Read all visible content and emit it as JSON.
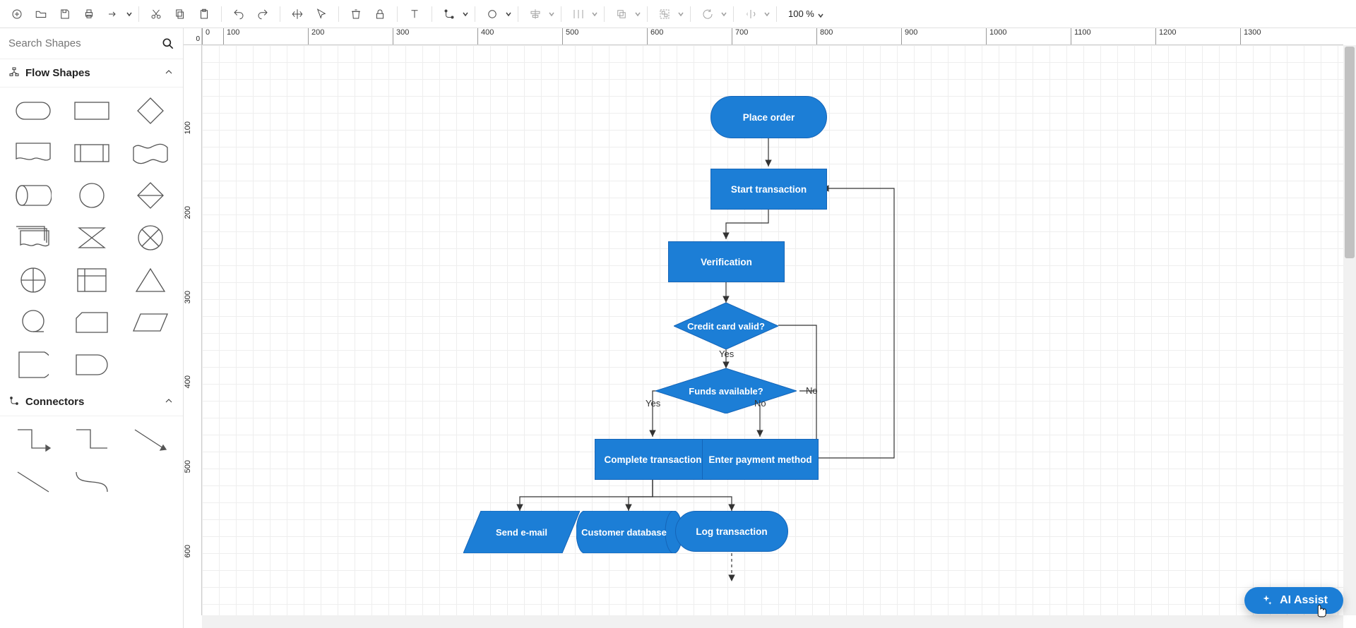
{
  "toolbar": {
    "zoom": "100 %"
  },
  "sidebar": {
    "search_placeholder": "Search Shapes",
    "flow_header": "Flow Shapes",
    "connectors_header": "Connectors"
  },
  "ruler": {
    "origin": "0",
    "hticks": [
      "0",
      "100",
      "200",
      "300",
      "400",
      "500",
      "600",
      "700",
      "800",
      "900",
      "1000",
      "1100",
      "1200",
      "1300"
    ],
    "vticks": [
      "100",
      "200",
      "300",
      "400",
      "500",
      "600"
    ]
  },
  "nodes": {
    "place_order": "Place order",
    "start_transaction": "Start transaction",
    "verification": "Verification",
    "credit_valid": "Credit card valid?",
    "funds_available": "Funds available?",
    "complete_transaction": "Complete transaction",
    "enter_payment": "Enter payment method",
    "send_email": "Send e-mail",
    "customer_db": "Customer database",
    "log_transaction": "Log transaction"
  },
  "edge_labels": {
    "yes1": "Yes",
    "no1": "No",
    "yes2": "Yes",
    "no2": "No"
  },
  "ai_assist": "AI Assist"
}
